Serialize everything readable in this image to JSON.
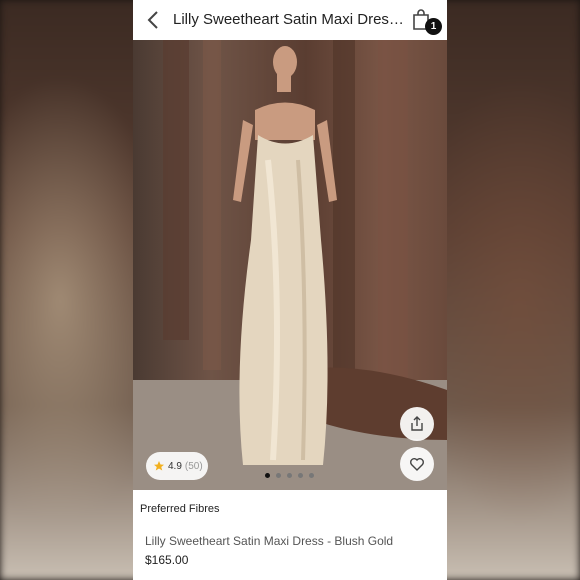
{
  "header": {
    "title": "Lilly Sweetheart Satin Maxi Dress...",
    "bag_count": "1"
  },
  "hero": {
    "rating_value": "4.9",
    "rating_count": "(50)",
    "carousel_dots": 5,
    "active_dot": 1
  },
  "product": {
    "badge": "Preferred Fibres",
    "name": "Lilly Sweetheart Satin Maxi Dress - Blush Gold",
    "price": "$165.00"
  },
  "colors": {
    "dress": "#e4d6bf",
    "curtain": "#6b4535",
    "star": "#f2b01e"
  }
}
